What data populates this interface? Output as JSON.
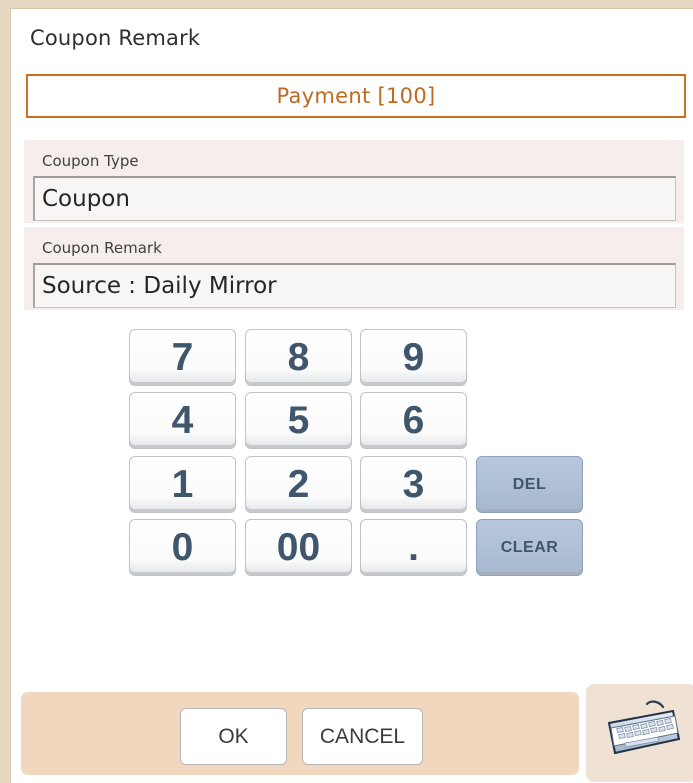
{
  "dialog": {
    "title": "Coupon Remark",
    "payment_label": "Payment [100]"
  },
  "fields": {
    "coupon_type": {
      "label": "Coupon Type",
      "value": "Coupon"
    },
    "coupon_remark": {
      "label": "Coupon Remark",
      "value": "Source : Daily Mirror"
    }
  },
  "keypad": {
    "k7": "7",
    "k8": "8",
    "k9": "9",
    "k4": "4",
    "k5": "5",
    "k6": "6",
    "k1": "1",
    "k2": "2",
    "k3": "3",
    "del": "DEL",
    "k0": "0",
    "k00": "00",
    "dot": ".",
    "clear": "CLEAR"
  },
  "actions": {
    "ok": "OK",
    "cancel": "CANCEL"
  },
  "icons": {
    "keyboard": "keyboard-icon"
  },
  "colors": {
    "accent": "#cc6f1f",
    "action_key": "#b8c7db",
    "bottom_bar": "#f0d7bd"
  }
}
